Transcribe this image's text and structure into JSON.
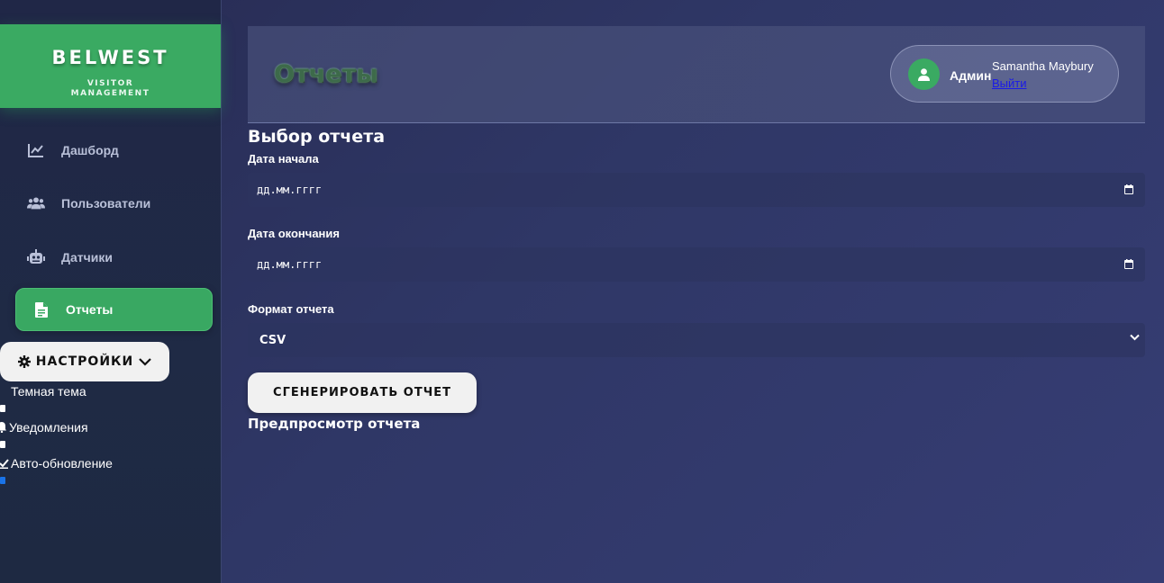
{
  "colors": {
    "accent": "#3aaa62",
    "background": "#2f3766",
    "sidebar": "#202747",
    "button_bg": "#f1f1f1",
    "link": "#1a1ae8"
  },
  "brand": {
    "name": "BELWEST",
    "sub_line1": "VISITOR",
    "sub_line2": "MANAGEMENT"
  },
  "sidebar": {
    "items": [
      {
        "label": "Дашборд",
        "icon": "chart-line-icon",
        "active": false
      },
      {
        "label": "Пользователи",
        "icon": "users-icon",
        "active": false
      },
      {
        "label": "Датчики",
        "icon": "robot-icon",
        "active": false
      },
      {
        "label": "Отчеты",
        "icon": "file-icon",
        "active": true
      }
    ],
    "settings": {
      "button_label": "НАСТРОЙКИ",
      "icon": "gear-icon",
      "chevron": "chevron-down-icon",
      "options": [
        {
          "label": "Темная тема",
          "icon": "moon-icon",
          "checked": false
        },
        {
          "label": "Уведомления",
          "icon": "bell-icon",
          "checked": false
        },
        {
          "label": "Авто-обновление",
          "icon": "check-icon",
          "checked": true
        }
      ]
    }
  },
  "header": {
    "title": "Отчеты",
    "user": {
      "role": "Админ",
      "name": "Samantha Maybury",
      "logout_label": "Выйти",
      "avatar_icon": "user-icon"
    }
  },
  "main": {
    "section_title": "Выбор отчета",
    "start_date": {
      "label": "Дата начала",
      "placeholder": "дд.мм.гггг"
    },
    "end_date": {
      "label": "Дата окончания",
      "placeholder": "дд.мм.гггг"
    },
    "format": {
      "label": "Формат отчета",
      "value": "CSV"
    },
    "generate_label": "СГЕНЕРИРОВАТЬ ОТЧЕТ",
    "preview_title": "Предпросмотр отчета"
  }
}
